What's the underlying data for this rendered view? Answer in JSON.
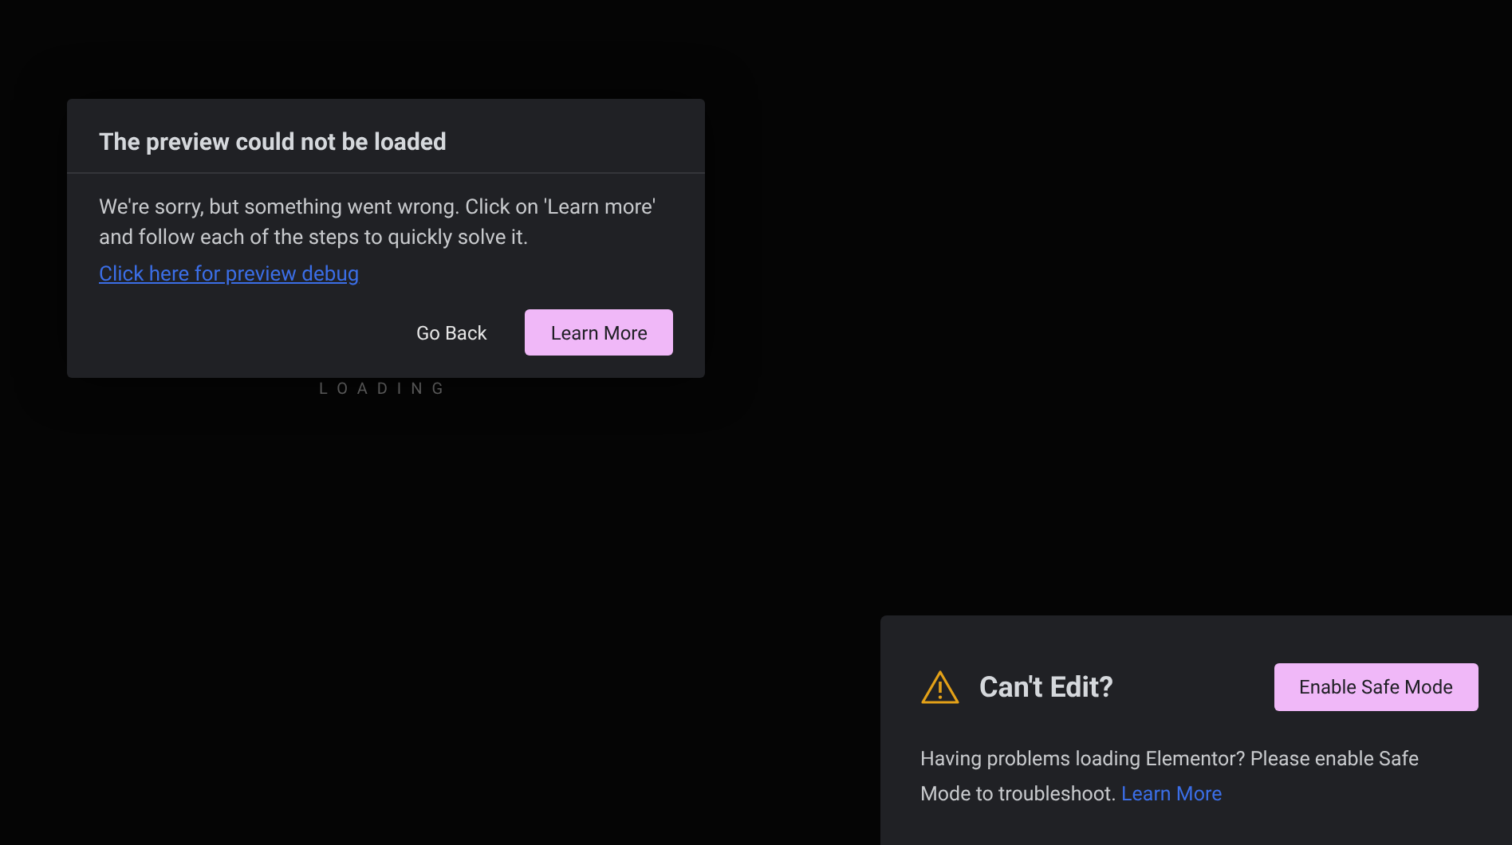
{
  "loading_text": "LOADING",
  "dialog": {
    "title": "The preview could not be loaded",
    "message": "We're sorry, but something went wrong. Click on 'Learn more' and follow each of the steps to quickly solve it.",
    "debug_link": "Click here for preview debug",
    "buttons": [
      {
        "label": "Go Back",
        "kind": "text"
      },
      {
        "label": "Learn More",
        "kind": "primary"
      }
    ]
  },
  "safe_mode": {
    "title": "Can't Edit?",
    "button": "Enable Safe Mode",
    "message": "Having problems loading Elementor? Please enable Safe Mode to troubleshoot.",
    "link": "Learn More"
  }
}
